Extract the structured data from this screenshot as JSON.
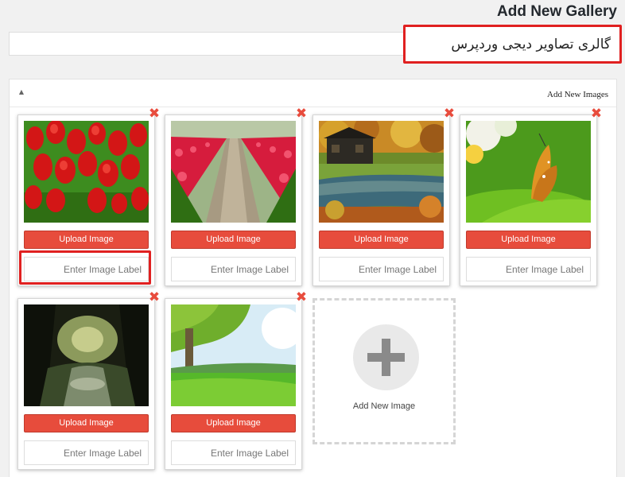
{
  "page": {
    "title": "Add New Gallery"
  },
  "gallery": {
    "title_value": "گالری تصاویر دیجی وردپرس"
  },
  "panel": {
    "title": "Add New Images",
    "toggle_glyph": "▲"
  },
  "common": {
    "upload_label": "Upload Image",
    "label_placeholder": "Enter Image Label",
    "remove_glyph": "✖"
  },
  "images": [
    {
      "subject": "red-tulips"
    },
    {
      "subject": "tulip-field-path"
    },
    {
      "subject": "autumn-cabin-lake"
    },
    {
      "subject": "butterfly-on-leaf"
    },
    {
      "subject": "dark-forest-stream"
    },
    {
      "subject": "green-meadow-tree"
    }
  ],
  "add_new": {
    "label": "Add New Image"
  },
  "colors": {
    "accent_red": "#e74c3c",
    "highlight": "#e02020"
  }
}
